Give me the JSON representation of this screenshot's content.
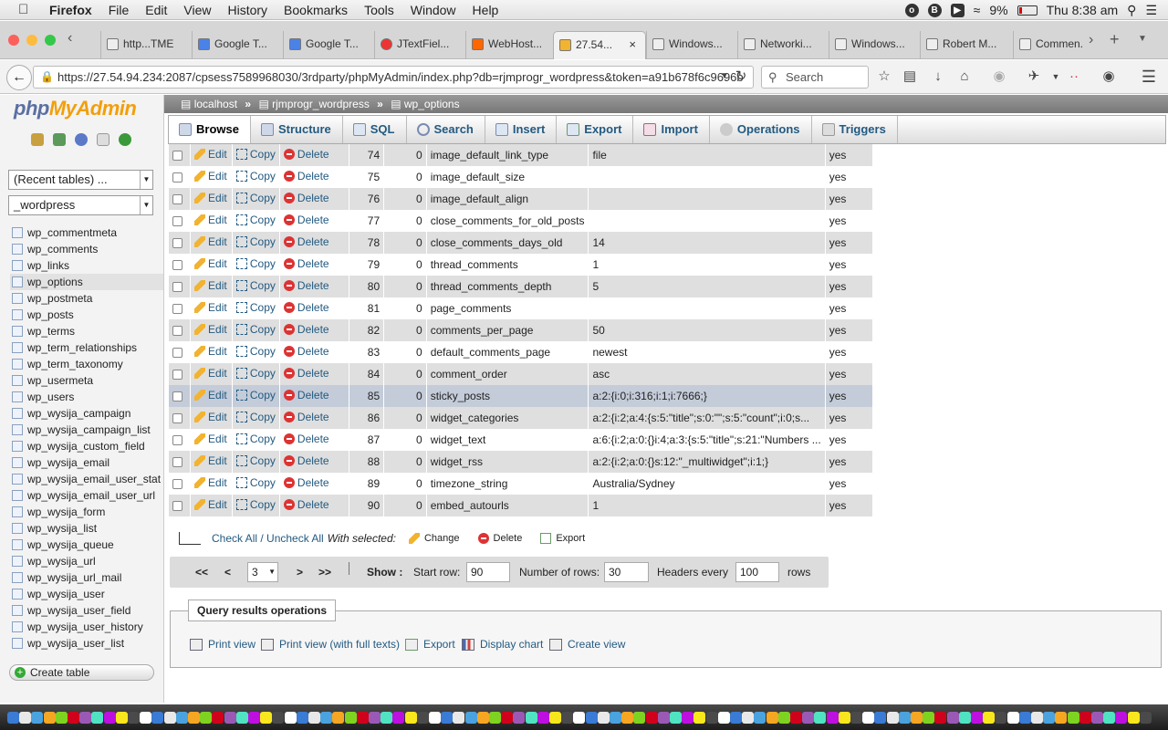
{
  "menubar": {
    "app": "Firefox",
    "items": [
      "File",
      "Edit",
      "View",
      "History",
      "Bookmarks",
      "Tools",
      "Window",
      "Help"
    ],
    "battery": "9%",
    "clock": "Thu 8:38 am"
  },
  "tabs": [
    {
      "label": "http...TME"
    },
    {
      "label": "Google T..."
    },
    {
      "label": "Google T..."
    },
    {
      "label": "JTextFiel..."
    },
    {
      "label": "WebHost..."
    },
    {
      "label": "27.54..."
    },
    {
      "label": "Windows..."
    },
    {
      "label": "Networki..."
    },
    {
      "label": "Windows..."
    },
    {
      "label": "Robert M..."
    },
    {
      "label": "Commen..."
    }
  ],
  "navbar": {
    "url": "https://27.54.94.234:2087/cpsess7589968030/3rdparty/phpMyAdmin/index.php?db=rjmprogr_wordpress&token=a91b678f6c9696b",
    "search_placeholder": "Search"
  },
  "sidebar": {
    "logo_php": "php",
    "logo_myadmin": "MyAdmin",
    "recent_tables": "(Recent tables) ...",
    "db_select": "_wordpress",
    "tables": [
      "wp_commentmeta",
      "wp_comments",
      "wp_links",
      "wp_options",
      "wp_postmeta",
      "wp_posts",
      "wp_terms",
      "wp_term_relationships",
      "wp_term_taxonomy",
      "wp_usermeta",
      "wp_users",
      "wp_wysija_campaign",
      "wp_wysija_campaign_list",
      "wp_wysija_custom_field",
      "wp_wysija_email",
      "wp_wysija_email_user_stat",
      "wp_wysija_email_user_url",
      "wp_wysija_form",
      "wp_wysija_list",
      "wp_wysija_queue",
      "wp_wysija_url",
      "wp_wysija_url_mail",
      "wp_wysija_user",
      "wp_wysija_user_field",
      "wp_wysija_user_history",
      "wp_wysija_user_list"
    ],
    "create_table": "Create table"
  },
  "breadcrumb": {
    "server": "localhost",
    "database": "rjmprogr_wordpress",
    "table": "wp_options"
  },
  "main_tabs": [
    "Browse",
    "Structure",
    "SQL",
    "Search",
    "Insert",
    "Export",
    "Import",
    "Operations",
    "Triggers"
  ],
  "row_actions": {
    "edit": "Edit",
    "copy": "Copy",
    "delete": "Delete"
  },
  "rows": [
    {
      "id": "74",
      "blog": "0",
      "name": "image_default_link_type",
      "value": "file",
      "autoload": "yes"
    },
    {
      "id": "75",
      "blog": "0",
      "name": "image_default_size",
      "value": "",
      "autoload": "yes"
    },
    {
      "id": "76",
      "blog": "0",
      "name": "image_default_align",
      "value": "",
      "autoload": "yes"
    },
    {
      "id": "77",
      "blog": "0",
      "name": "close_comments_for_old_posts",
      "value": "",
      "autoload": "yes"
    },
    {
      "id": "78",
      "blog": "0",
      "name": "close_comments_days_old",
      "value": "14",
      "autoload": "yes"
    },
    {
      "id": "79",
      "blog": "0",
      "name": "thread_comments",
      "value": "1",
      "autoload": "yes"
    },
    {
      "id": "80",
      "blog": "0",
      "name": "thread_comments_depth",
      "value": "5",
      "autoload": "yes"
    },
    {
      "id": "81",
      "blog": "0",
      "name": "page_comments",
      "value": "",
      "autoload": "yes"
    },
    {
      "id": "82",
      "blog": "0",
      "name": "comments_per_page",
      "value": "50",
      "autoload": "yes"
    },
    {
      "id": "83",
      "blog": "0",
      "name": "default_comments_page",
      "value": "newest",
      "autoload": "yes"
    },
    {
      "id": "84",
      "blog": "0",
      "name": "comment_order",
      "value": "asc",
      "autoload": "yes"
    },
    {
      "id": "85",
      "blog": "0",
      "name": "sticky_posts",
      "value": "a:2:{i:0;i:316;i:1;i:7666;}",
      "autoload": "yes"
    },
    {
      "id": "86",
      "blog": "0",
      "name": "widget_categories",
      "value": "a:2:{i:2;a:4:{s:5:\"title\";s:0:\"\";s:5:\"count\";i:0;s...",
      "autoload": "yes"
    },
    {
      "id": "87",
      "blog": "0",
      "name": "widget_text",
      "value": "a:6:{i:2;a:0:{}i:4;a:3:{s:5:\"title\";s:21:\"Numbers ...",
      "autoload": "yes"
    },
    {
      "id": "88",
      "blog": "0",
      "name": "widget_rss",
      "value": "a:2:{i:2;a:0:{}s:12:\"_multiwidget\";i:1;}",
      "autoload": "yes"
    },
    {
      "id": "89",
      "blog": "0",
      "name": "timezone_string",
      "value": "Australia/Sydney",
      "autoload": "yes"
    },
    {
      "id": "90",
      "blog": "0",
      "name": "embed_autourls",
      "value": "1",
      "autoload": "yes"
    }
  ],
  "highlighted_row_index": 11,
  "with_selected": {
    "check_all": "Check All / Uncheck All",
    "with_selected": "With selected:",
    "change": "Change",
    "delete": "Delete",
    "export": "Export"
  },
  "pagination": {
    "first": "<<",
    "prev": "<",
    "page": "3",
    "next": ">",
    "last": ">>",
    "show": "Show :",
    "start_row_label": "Start row:",
    "start_row": "90",
    "num_rows_label": "Number of rows:",
    "num_rows": "30",
    "headers_every_label": "Headers every",
    "headers_every": "100",
    "rows_label": "rows"
  },
  "query_ops": {
    "title": "Query results operations",
    "print_view": "Print view",
    "print_view_full": "Print view (with full texts)",
    "export": "Export",
    "display_chart": "Display chart",
    "create_view": "Create view"
  }
}
